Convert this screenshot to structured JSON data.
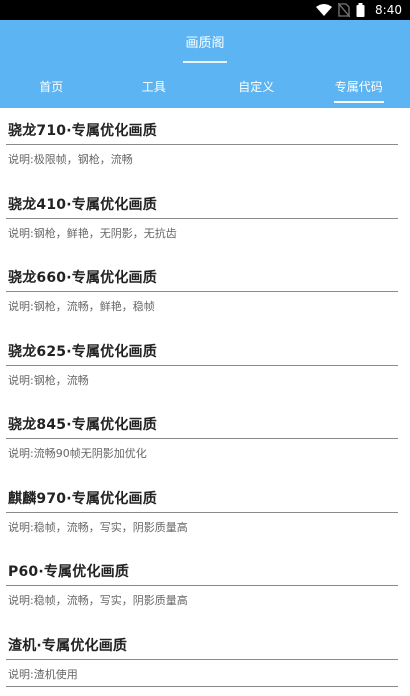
{
  "status_bar": {
    "time": "8:40",
    "icons": [
      "wifi-icon",
      "no-sim-icon",
      "battery-icon"
    ]
  },
  "app_bar": {
    "title": "画质阁"
  },
  "tabs": [
    {
      "label": "首页",
      "active": false
    },
    {
      "label": "工具",
      "active": false
    },
    {
      "label": "自定义",
      "active": false
    },
    {
      "label": "专属代码",
      "active": true
    }
  ],
  "items": [
    {
      "title": "骁龙710·专属优化画质",
      "desc": "说明:极限帧，钢枪，流畅"
    },
    {
      "title": "骁龙410·专属优化画质",
      "desc": "说明:钢枪，鲜艳，无阴影，无抗齿"
    },
    {
      "title": "骁龙660·专属优化画质",
      "desc": "说明:钢枪，流畅，鲜艳，稳帧"
    },
    {
      "title": "骁龙625·专属优化画质",
      "desc": "说明:钢枪，流畅"
    },
    {
      "title": "骁龙845·专属优化画质",
      "desc": "说明:流畅90帧无阴影加优化"
    },
    {
      "title": "麒麟970·专属优化画质",
      "desc": "说明:稳帧，流畅，写实，阴影质量高"
    },
    {
      "title": "P60·专属优化画质",
      "desc": "说明:稳帧，流畅，写实，阴影质量高"
    },
    {
      "title": "渣机·专属优化画质",
      "desc": "说明:渣机使用"
    }
  ],
  "colors": {
    "primary": "#5DB4F2",
    "status_bar": "#000000",
    "divider": "#8a8a8a"
  }
}
